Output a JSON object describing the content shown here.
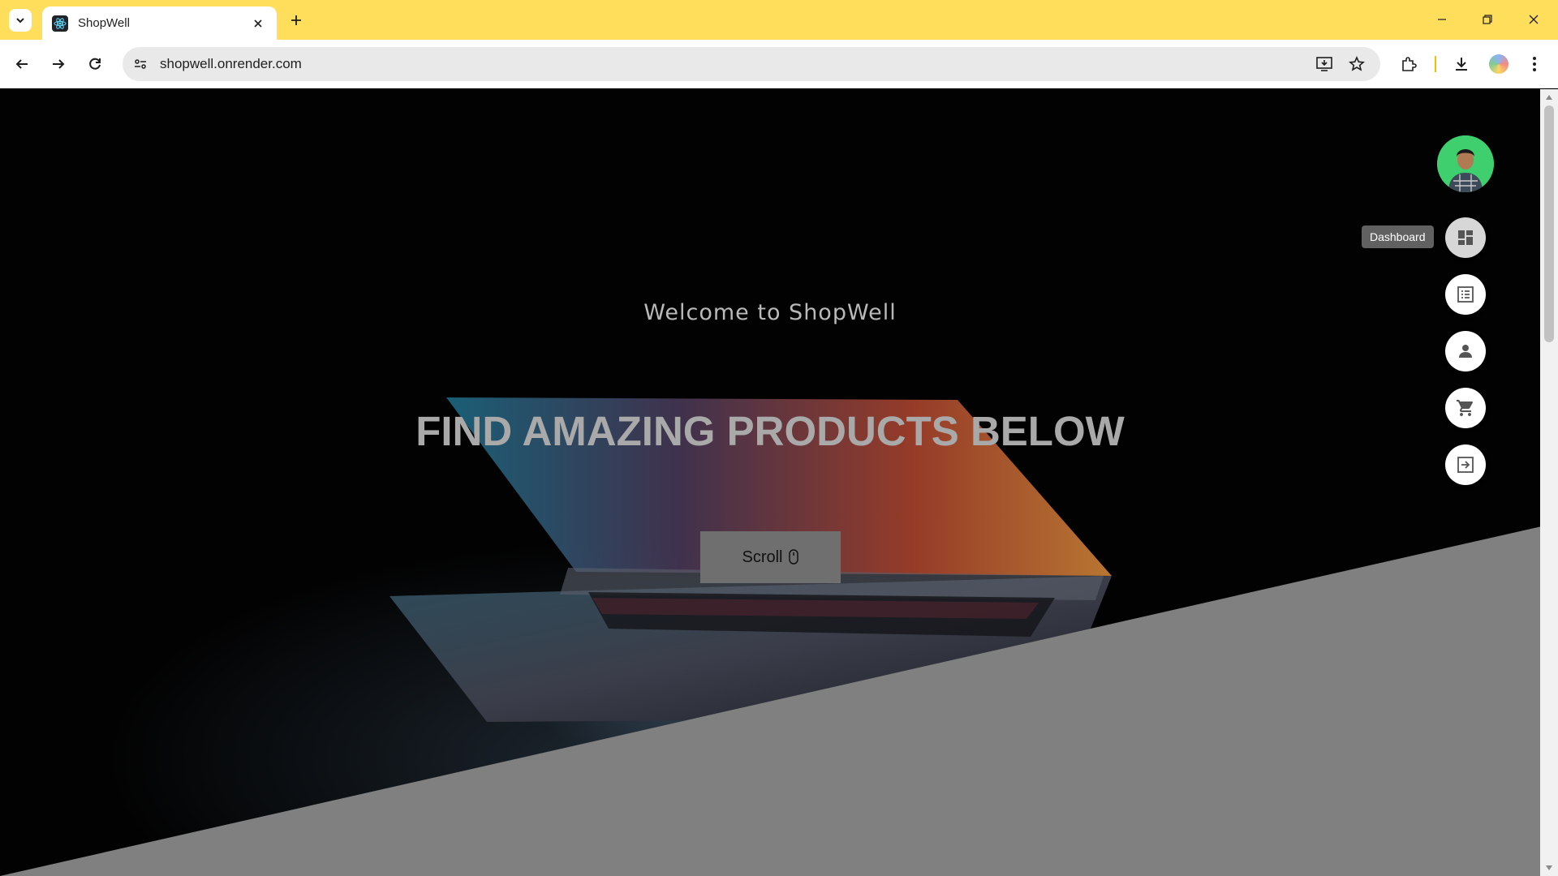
{
  "browser": {
    "tab": {
      "title": "ShopWell",
      "favicon": "react-icon"
    },
    "url": "shopwell.onrender.com"
  },
  "hero": {
    "welcome": "Welcome to ShopWell",
    "headline": "FIND AMAZING PRODUCTS BELOW",
    "scroll_button": "Scroll"
  },
  "speed_dial": {
    "items": [
      {
        "name": "dashboard",
        "icon": "dashboard-icon",
        "tooltip": "Dashboard"
      },
      {
        "name": "orders",
        "icon": "list-icon"
      },
      {
        "name": "profile",
        "icon": "person-icon"
      },
      {
        "name": "cart",
        "icon": "cart-icon"
      },
      {
        "name": "logout",
        "icon": "exit-icon"
      }
    ]
  },
  "colors": {
    "tabbar": "#ffde5c",
    "diagonal": "#808080",
    "avatar_bg": "#3fcf6e"
  }
}
